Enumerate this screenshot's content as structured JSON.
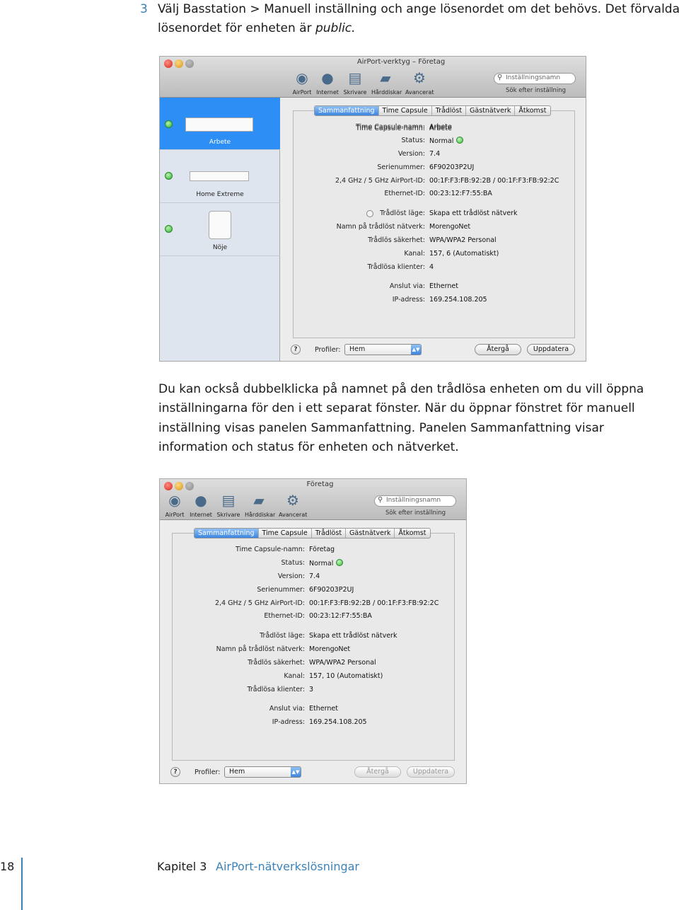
{
  "step": {
    "number": "3",
    "line1": "Välj Basstation > Manuell inställning och ange lösenordet om det behövs. Det förvalda",
    "line2_prefix": "lösenordet för enheten är ",
    "line2_em": "public."
  },
  "paragraph": "Du kan också dubbelklicka på namnet på den trådlösa enheten om du vill öppna inställningarna för den i ett separat fönster. När du öppnar fönstret för manuell inställning visas panelen Sammanfattning. Panelen Sammanfattning visar information och status för enheten och nätverket.",
  "toolbar": {
    "airport": "AirPort",
    "internet": "Internet",
    "printers": "Skrivare",
    "disks": "Hårddiskar",
    "advanced": "Avancerat",
    "search_placeholder": "Inställningsnamn",
    "search_hint": "Sök efter inställning"
  },
  "tabs": [
    "Sammanfattning",
    "Time Capsule",
    "Trådlöst",
    "Gästnätverk",
    "Åtkomst"
  ],
  "labels": {
    "name": "Time Capsule-namn:",
    "status": "Status:",
    "version": "Version:",
    "serial": "Serienummer:",
    "airport_id": "2,4 GHz / 5 GHz AirPort-ID:",
    "ethernet_id": "Ethernet-ID:",
    "wireless_mode": "Trådlöst läge:",
    "network_name": "Namn på trådlöst nätverk:",
    "security": "Trådlös säkerhet:",
    "channel": "Kanal:",
    "clients": "Trådlösa klienter:",
    "connect_via": "Anslut via:",
    "ip": "IP-adress:",
    "profiles": "Profiler:",
    "help": "?"
  },
  "window1": {
    "title": "AirPort-verktyg – Företag",
    "devices": [
      {
        "name": "Arbete",
        "selected": true
      },
      {
        "name": "Home Extreme",
        "selected": false
      },
      {
        "name": "Nöje",
        "selected": false
      }
    ],
    "values": {
      "name": "Arbete",
      "status": "Normal",
      "version": "7.4",
      "serial": "6F90203P2UJ",
      "airport_id": "00:1F:F3:FB:92:2B / 00:1F:F3:FB:92:2C",
      "ethernet_id": "00:23:12:F7:55:BA",
      "wireless_mode": "Skapa ett trådlöst nätverk",
      "network_name": "MorengoNet",
      "security": "WPA/WPA2 Personal",
      "channel": "157, 6 (Automatiskt)",
      "clients": "4",
      "connect_via": "Ethernet",
      "ip": "169.254.108.205"
    },
    "profile": "Hem",
    "revert": "Återgå",
    "update": "Uppdatera"
  },
  "window2": {
    "title": "Företag",
    "values": {
      "name": "Företag",
      "status": "Normal",
      "version": "7.4",
      "serial": "6F90203P2UJ",
      "airport_id": "00:1F:F3:FB:92:2B / 00:1F:F3:FB:92:2C",
      "ethernet_id": "00:23:12:F7:55:BA",
      "wireless_mode": "Skapa ett trådlöst nätverk",
      "network_name": "MorengoNet",
      "security": "WPA/WPA2 Personal",
      "channel": "157, 10 (Automatiskt)",
      "clients": "3",
      "connect_via": "Ethernet",
      "ip": "169.254.108.205"
    },
    "profile": "Hem",
    "revert": "Återgå",
    "update": "Uppdatera"
  },
  "footer": {
    "page": "18",
    "chapter": "Kapitel 3",
    "chapter_name": "AirPort-nätverkslösningar"
  },
  "colors": {
    "accent": "#3a83b8",
    "selection": "#2d8ef5",
    "status_ok": "#38b838"
  }
}
